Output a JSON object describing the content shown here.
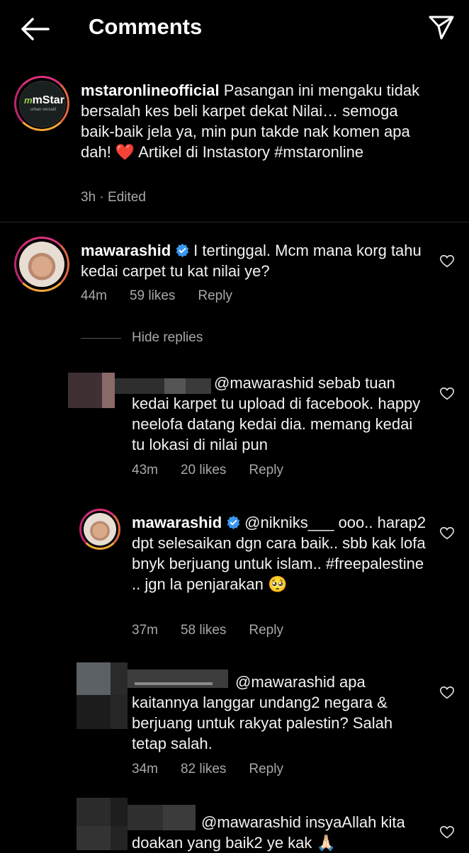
{
  "header": {
    "title": "Comments"
  },
  "caption": {
    "username": "mstaronlineofficial",
    "text": "Pasangan ini mengaku tidak bersalah kes beli karpet dekat Nilai… semoga baik-baik jela ya, min pun takde nak komen apa dah! ❤️ Artikel di Instastory #mstaronline",
    "time": "3h · Edited",
    "logo_text": "mStar",
    "logo_sub": "urban versatil"
  },
  "comments": [
    {
      "username": "mawarashid",
      "text": "I tertinggal. Mcm mana korg tahu kedai carpet tu kat nilai ye?",
      "time": "44m",
      "likes": "59 likes",
      "reply": "Reply"
    }
  ],
  "hide_replies": "Hide replies",
  "replies": [
    {
      "username": "",
      "text": "@mawarashid sebab tuan kedai karpet tu upload di facebook. happy neelofa datang kedai dia. memang kedai tu lokasi di nilai pun",
      "time": "43m",
      "likes": "20 likes",
      "reply": "Reply"
    },
    {
      "username": "mawarashid",
      "text": "@nikniks___ ooo.. harap2 dpt selesaikan dgn cara baik.. sbb kak lofa bnyk berjuang untuk islam.. #freepalestine .. jgn la penjarakan 🥺",
      "time": "37m",
      "likes": "58 likes",
      "reply": "Reply"
    },
    {
      "username": "",
      "text": "@mawarashid apa kaitannya langgar undang2 negara & berjuang untuk rakyat palestin? Salah tetap salah.",
      "time": "34m",
      "likes": "82 likes",
      "reply": "Reply"
    },
    {
      "username": "",
      "text": "@mawarashid insyaAllah kita doakan yang baik2 ye kak 🙏🏻",
      "time": "",
      "likes": "",
      "reply": ""
    }
  ],
  "icons": {
    "back": "arrow-left-icon",
    "share": "paper-plane-icon",
    "like": "heart-outline-icon",
    "verified": "verified-badge-icon"
  },
  "colors": {
    "background": "#000000",
    "verified": "#3897f0",
    "story_ring": "#d9317a"
  }
}
